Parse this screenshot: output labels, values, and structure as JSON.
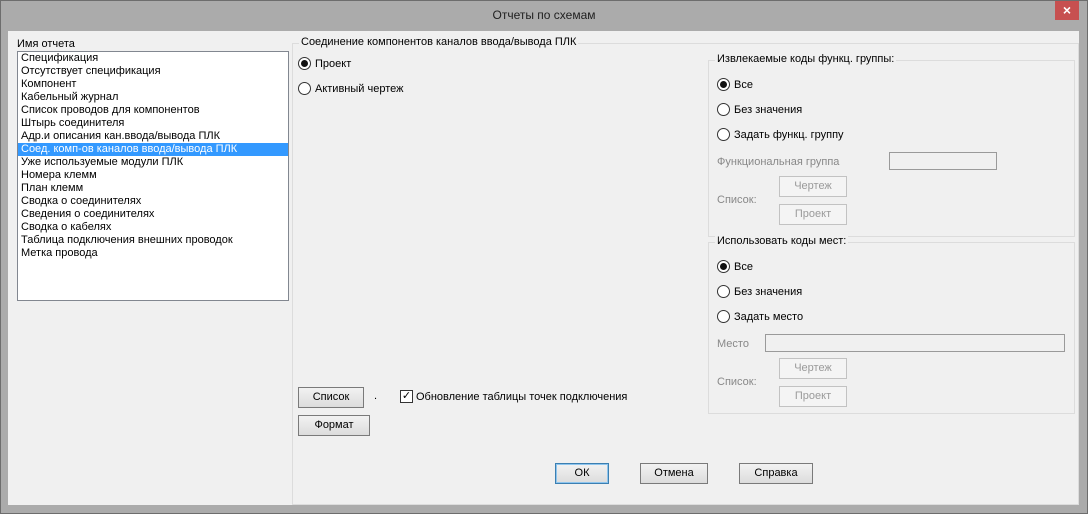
{
  "window": {
    "title": "Отчеты по схемам",
    "close_glyph": "×"
  },
  "report_list": {
    "label": "Имя отчета",
    "items": [
      "Спецификация",
      "Отсутствует спецификация",
      "Компонент",
      "Кабельный журнал",
      "Список проводов для компонентов",
      "Штырь соединителя",
      "Адр.и описания кан.ввода/вывода ПЛК",
      "Соед. комп-ов каналов ввода/вывода ПЛК",
      "Уже используемые модули ПЛК",
      "Номера клемм",
      "План клемм",
      "Сводка о соединителях",
      "Сведения о соединителях",
      "Сводка о кабелях",
      "Таблица подключения внешних проводок",
      "Метка провода"
    ],
    "selected_index": 7
  },
  "main_group": {
    "title": "Соединение компонентов каналов ввода/вывода ПЛК"
  },
  "scope": {
    "project_label": "Проект",
    "active_drawing_label": "Активный чертеж",
    "selected": "project"
  },
  "func_group": {
    "title": "Извлекаемые коды функц. группы:",
    "all_label": "Все",
    "no_value_label": "Без значения",
    "set_label": "Задать функц. группу",
    "selected": "all",
    "field_label": "Функциональная группа",
    "field_value": "",
    "list_label": "Список:",
    "drawing_button": "Чертеж",
    "project_button": "Проект"
  },
  "location": {
    "title": "Использовать коды мест:",
    "all_label": "Все",
    "no_value_label": "Без значения",
    "set_label": "Задать место",
    "selected": "all",
    "field_label": "Место",
    "field_value": "",
    "list_label": "Список:",
    "drawing_button": "Чертеж",
    "project_button": "Проект"
  },
  "bottom": {
    "list_button": "Список",
    "dot_text": ".",
    "update_checkbox_label": "Обновление таблицы точек подключения",
    "update_checked": true,
    "format_button": "Формат",
    "ok_button": "ОК",
    "cancel_button": "Отмена",
    "help_button": "Справка"
  }
}
